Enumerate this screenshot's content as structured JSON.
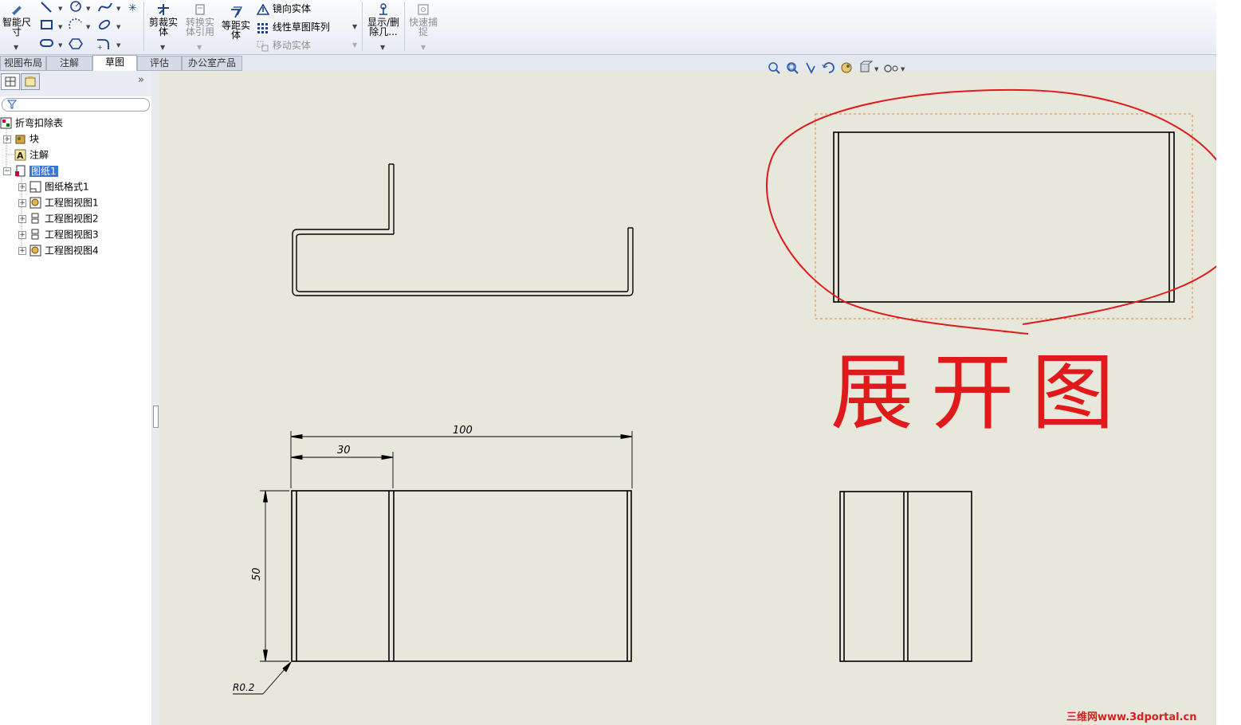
{
  "ribbon": {
    "smart_dim": "智能尺\n寸",
    "trim": "剪裁实\n体",
    "convert": "转换实\n体引用",
    "offset": "等距实\n体",
    "mirror": "镜向实体",
    "linear_pattern": "线性草图阵列",
    "move": "移动实体",
    "display_delete": "显示/删\n除几...",
    "quick_snap": "快速捕\n捉"
  },
  "tabs": [
    {
      "label": "视图布局"
    },
    {
      "label": "注解"
    },
    {
      "label": "草图"
    },
    {
      "label": "评估"
    },
    {
      "label": "办公室产品"
    }
  ],
  "tree": {
    "root": "折弯扣除表",
    "items": [
      {
        "label": "块"
      },
      {
        "label": "注解"
      },
      {
        "label": "图纸1"
      },
      {
        "label": "图纸格式1"
      },
      {
        "label": "工程图视图1"
      },
      {
        "label": "工程图视图2"
      },
      {
        "label": "工程图视图3"
      },
      {
        "label": "工程图视图4"
      }
    ]
  },
  "drawing": {
    "dim_overall": "100",
    "dim_segment": "30",
    "dim_height": "50",
    "radius_note": "R0.2",
    "annotation": "展开图"
  },
  "watermark": "三维网www.3dportal.cn",
  "colors": {
    "canvas": "#e8e7dc",
    "annotation_red": "#e01a1a",
    "selection": "#3875d7"
  },
  "icons": [
    "smart-dimension-icon",
    "line-icon",
    "circle-icon",
    "spline-icon",
    "rectangle-icon",
    "arc-icon",
    "slot-icon",
    "polygon-icon",
    "fillet-icon",
    "trim-icon",
    "convert-icon",
    "offset-icon",
    "mirror-icon",
    "pattern-icon",
    "move-icon",
    "display-relations-icon",
    "quick-snap-icon",
    "zoom-fit-icon",
    "zoom-area-icon",
    "previous-view-icon",
    "rotate-icon",
    "pan-icon",
    "view-orientation-icon",
    "hide-show-icon",
    "filter-icon"
  ]
}
